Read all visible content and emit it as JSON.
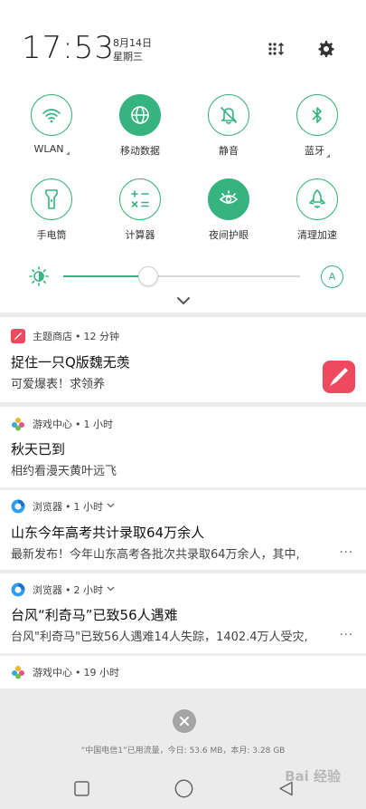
{
  "status": {
    "time": "17:53",
    "date": "8月14日",
    "weekday": "星期三"
  },
  "header_icons": [
    "edit-grid-icon",
    "settings-icon"
  ],
  "quick_settings": [
    {
      "label": "WLAN",
      "icon": "wifi-icon",
      "active": false,
      "has_arrow": true
    },
    {
      "label": "移动数据",
      "icon": "globe-icon",
      "active": true,
      "has_arrow": false
    },
    {
      "label": "静音",
      "icon": "bell-muted-icon",
      "active": false,
      "has_arrow": false
    },
    {
      "label": "蓝牙",
      "icon": "bluetooth-icon",
      "active": false,
      "has_arrow": true
    },
    {
      "label": "手电筒",
      "icon": "flashlight-icon",
      "active": false,
      "has_arrow": false
    },
    {
      "label": "计算器",
      "icon": "calculator-icon",
      "active": false,
      "has_arrow": false
    },
    {
      "label": "夜间护眼",
      "icon": "eye-care-icon",
      "active": true,
      "has_arrow": false
    },
    {
      "label": "清理加速",
      "icon": "rocket-icon",
      "active": false,
      "has_arrow": false
    }
  ],
  "brightness": {
    "level": 0.36,
    "auto_label": "A"
  },
  "notifications": [
    {
      "app": "主题商店",
      "time": "12 分钟",
      "title": "捉住一只Q版魏无羡",
      "body": "可爱爆表！求领养"
    },
    {
      "app": "游戏中心",
      "time": "1 小时",
      "title": "秋天已到",
      "body": "相约看漫天黄叶远飞"
    },
    {
      "app": "浏览器",
      "time": "1 小时",
      "title": "山东今年高考共计录取64万余人",
      "body": "最新发布！今年山东高考各批次共录取64万余人，其中,",
      "more": "..."
    },
    {
      "app": "浏览器",
      "time": "2 小时",
      "title": "台风“利奇马”已致56人遇难",
      "body": "台风\"利奇马\"已致56人遇难14人失踪，1402.4万人受灾,",
      "more": "..."
    },
    {
      "app": "游戏中心",
      "time": "19 小时"
    }
  ],
  "separator": "•",
  "data_usage": "“中国电信1”已用流量，今日: 53.6 MB，本月: 3.28 GB",
  "watermark": "Bai 经验",
  "colors": {
    "accent": "#36b37e",
    "background": "#ebebeb"
  }
}
